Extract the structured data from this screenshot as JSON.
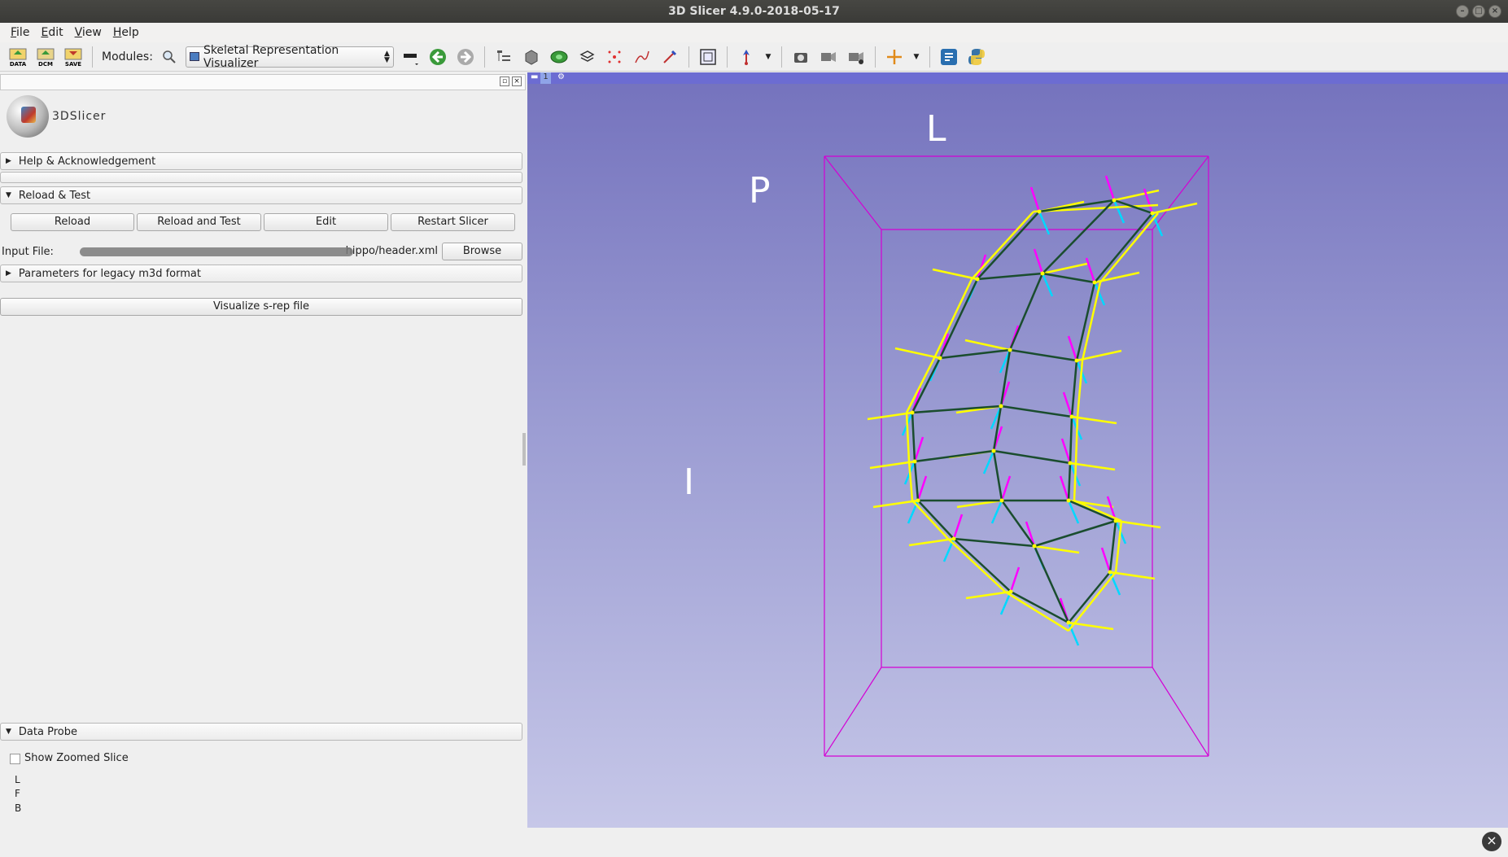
{
  "window": {
    "title": "3D Slicer 4.9.0-2018-05-17"
  },
  "menu": [
    "File",
    "Edit",
    "View",
    "Help"
  ],
  "toolbar": {
    "data_label": "DATA",
    "dcm_label": "DCM",
    "save_label": "SAVE",
    "modules_label": "Modules:",
    "module_selected": "Skeletal Representation Visualizer"
  },
  "logo": {
    "text": "3DSlicer"
  },
  "sections": {
    "help": "Help & Acknowledgement",
    "reload_test": "Reload & Test",
    "legacy": "Parameters for legacy m3d format",
    "data_probe": "Data Probe"
  },
  "reload_buttons": [
    "Reload",
    "Reload and Test",
    "Edit",
    "Restart Slicer"
  ],
  "input": {
    "label": "Input File:",
    "value": "hippo/header.xml",
    "browse": "Browse"
  },
  "visualize_button": "Visualize s-rep file",
  "data_probe": {
    "show_zoomed": "Show Zoomed Slice",
    "L": "L",
    "F": "F",
    "B": "B"
  },
  "view": {
    "number": "1",
    "orientation": {
      "top": "L",
      "left": "P",
      "side": "I"
    }
  },
  "colors": {
    "box": "#d400d4",
    "mesh": "#1a4d2e",
    "spoke_out": "#ffff00",
    "spoke_a": "#ff00ff",
    "spoke_b": "#00d8ff",
    "view_top": "#7472bd",
    "view_bottom": "#c6c7e8"
  }
}
